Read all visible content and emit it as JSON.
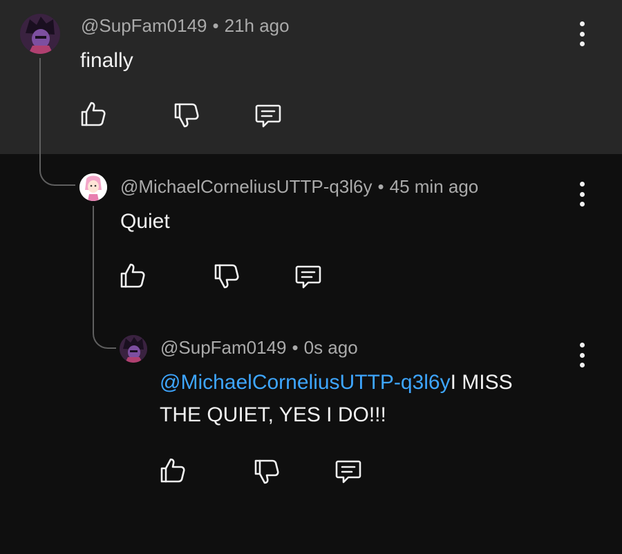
{
  "comments": [
    {
      "author": "@SupFam0149",
      "separator": "•",
      "time": "21h ago",
      "text": "finally"
    },
    {
      "author": "@MichaelCorneliusUTTP-q3l6y",
      "separator": "•",
      "time": "45 min ago",
      "text": "Quiet"
    },
    {
      "author": "@SupFam0149",
      "separator": "•",
      "time": "0s ago",
      "mention": "@MichaelCorneliusUTTP-q3l6y",
      "text_line1": "I MISS",
      "text_line2": "THE QUIET, YES I DO!!!"
    }
  ],
  "icons": {
    "like": "thumbs-up-icon",
    "dislike": "thumbs-down-icon",
    "reply": "reply-icon",
    "more": "more-vertical-icon"
  },
  "colors": {
    "top_background": "#272727",
    "background": "#0f0f0f",
    "meta_text": "#aaaaaa",
    "mention": "#3ea6ff"
  }
}
